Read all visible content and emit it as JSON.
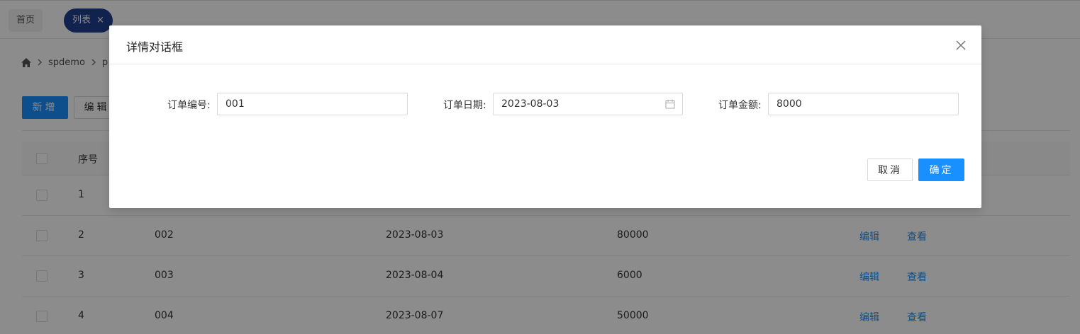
{
  "tabs": {
    "home_label": "首页",
    "list_label": "列表",
    "close_glyph": "×"
  },
  "breadcrumb": {
    "items": [
      "spdemo",
      "p"
    ]
  },
  "toolbar": {
    "add_label": "新增",
    "edit_label": "编辑"
  },
  "table": {
    "seq_header": "序号",
    "rows": [
      {
        "seq": "1",
        "no": "",
        "date": "",
        "amount": ""
      },
      {
        "seq": "2",
        "no": "002",
        "date": "2023-08-03",
        "amount": "80000",
        "edit": "编辑",
        "view": "查看"
      },
      {
        "seq": "3",
        "no": "003",
        "date": "2023-08-04",
        "amount": "6000",
        "edit": "编辑",
        "view": "查看"
      },
      {
        "seq": "4",
        "no": "004",
        "date": "2023-08-07",
        "amount": "50000",
        "edit": "编辑",
        "view": "查看"
      }
    ]
  },
  "modal": {
    "title": "详情对话框",
    "fields": {
      "order_no_label": "订单编号:",
      "order_no_value": "001",
      "order_date_label": "订单日期:",
      "order_date_value": "2023-08-03",
      "order_amount_label": "订单金额:",
      "order_amount_value": "8000"
    },
    "cancel_label": "取消",
    "ok_label": "确定"
  },
  "colors": {
    "primary": "#1890ff",
    "tab_active": "#1f3f8f",
    "mask": "rgba(0,0,0,0.45)"
  },
  "icons": [
    "home-icon",
    "chevron-right-icon",
    "close-icon",
    "calendar-icon"
  ]
}
